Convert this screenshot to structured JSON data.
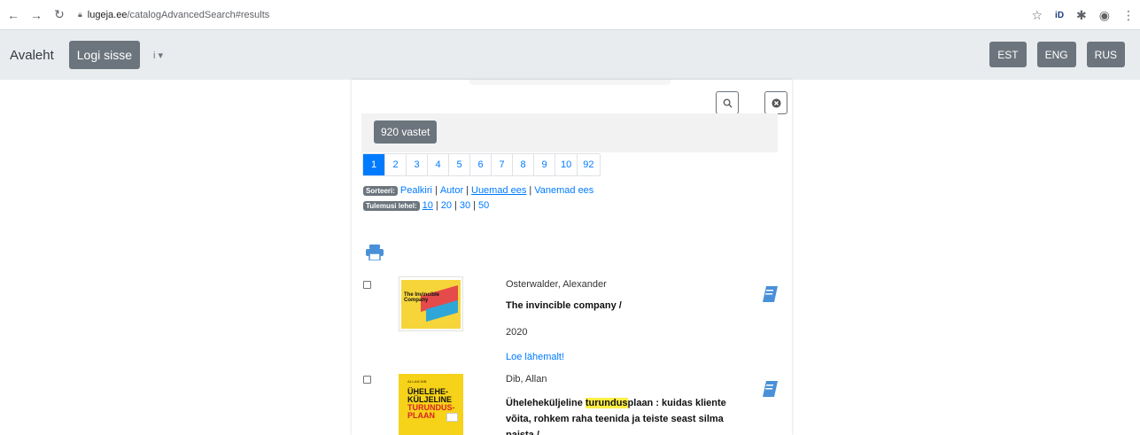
{
  "browser": {
    "url_host": "lugeja.ee",
    "url_path": "/catalogAdvancedSearch#results",
    "id_label": "iD"
  },
  "navbar": {
    "home": "Avaleht",
    "login": "Logi sisse",
    "info": "i ▾",
    "languages": [
      "EST",
      "ENG",
      "RUS"
    ]
  },
  "search": {
    "results_count": "920 vastet"
  },
  "pagination": [
    "1",
    "2",
    "3",
    "4",
    "5",
    "6",
    "7",
    "8",
    "9",
    "10",
    "92"
  ],
  "sort": {
    "badge": "Sorteeri:",
    "options": [
      "Pealkiri",
      "Autor",
      "Uuemad ees",
      "Vanemad ees"
    ]
  },
  "per_page": {
    "badge": "Tulemusi lehel:",
    "options": [
      "10",
      "20",
      "30",
      "50"
    ]
  },
  "results": [
    {
      "author": "Osterwalder, Alexander",
      "title": "The invincible company /",
      "year": "2020",
      "more": "Loe lähemalt!",
      "cover_text": "The Invincible Company"
    },
    {
      "author": "Dib, Allan",
      "title_pre": "Üheleheküljeline ",
      "title_hl": "turundus",
      "title_post": "plaan : kuidas kliente võita, rohkem raha teenida ja teiste seast silma paista /",
      "cover_author": "ALLAN DIB",
      "cover_line1": "ÜHELEHE-",
      "cover_line2": "KÜLJELINE",
      "cover_line3": "TURUNDUS-",
      "cover_line4": "PLAAN"
    }
  ],
  "colors": {
    "primary": "#007bff",
    "secondary": "#6c757d",
    "navbar_bg": "#e9ecef",
    "highlight": "#ffee44"
  }
}
